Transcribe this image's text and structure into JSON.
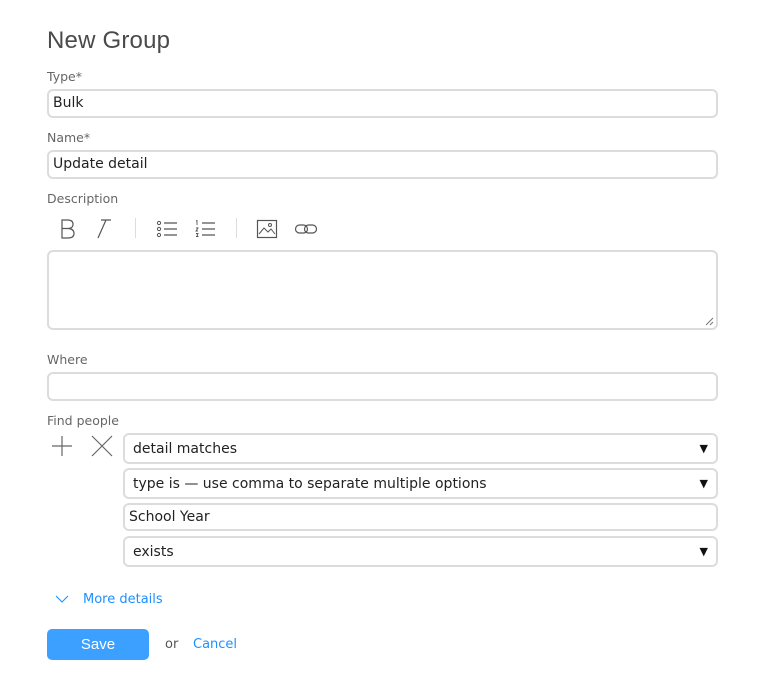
{
  "page": {
    "title": "New Group"
  },
  "type_field": {
    "label": "Type*",
    "value": "Bulk"
  },
  "name_field": {
    "label": "Name*",
    "value": "Update detail"
  },
  "description": {
    "label": "Description",
    "toolbar": [
      "bold-icon",
      "italic-icon",
      "bullet-list-icon",
      "numbered-list-icon",
      "image-icon",
      "link-icon"
    ],
    "value": ""
  },
  "where_field": {
    "label": "Where",
    "value": ""
  },
  "find_people": {
    "label": "Find people",
    "rule_select": "detail matches",
    "type_select": "type is — use comma to separate multiple options",
    "detail_value": "School Year",
    "condition_select": "exists",
    "caret": "▼"
  },
  "more_details": {
    "label": "More details"
  },
  "actions": {
    "save": "Save",
    "or": "or",
    "cancel": "Cancel"
  },
  "colors": {
    "accent": "#3ba0ff",
    "link": "#1e90ff",
    "border": "#dcdcdc"
  }
}
